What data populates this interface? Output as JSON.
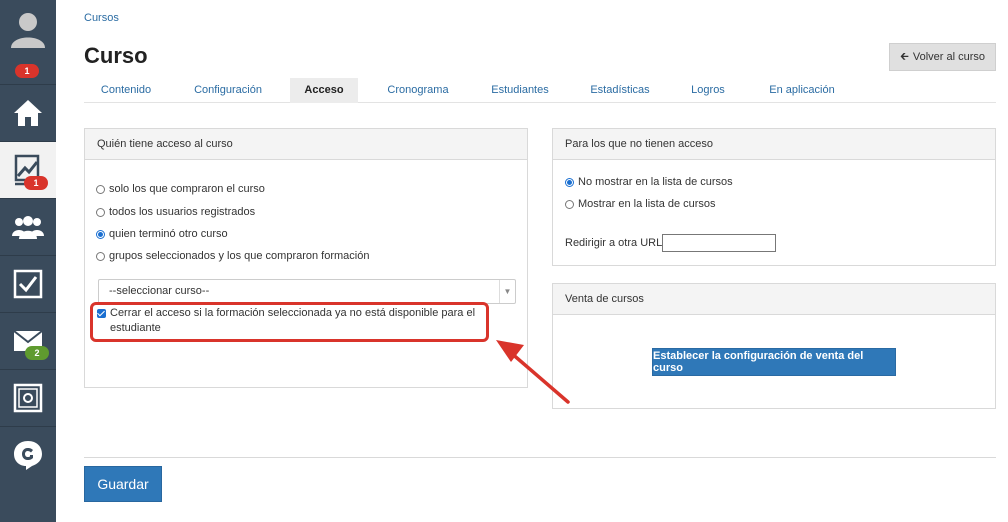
{
  "sidebar": {
    "items": [
      {
        "icon": "user-avatar-icon",
        "badge": "1",
        "badge_color": "#d9342b"
      },
      {
        "icon": "home-icon"
      },
      {
        "icon": "courses-chart-icon",
        "badge": "1",
        "badge_color": "#d9342b",
        "active": true
      },
      {
        "icon": "users-group-icon"
      },
      {
        "icon": "checkbox-tasks-icon"
      },
      {
        "icon": "mail-icon",
        "badge": "2",
        "badge_color": "#5f9b2f"
      },
      {
        "icon": "safe-icon"
      },
      {
        "icon": "brand-logo-icon"
      }
    ]
  },
  "breadcrumb": "Cursos",
  "page_title": "Curso",
  "back_button": {
    "label": "Volver al curso",
    "icon": "arrow-left-icon"
  },
  "tabs": [
    {
      "label": "Contenido"
    },
    {
      "label": "Configuración"
    },
    {
      "label": "Acceso",
      "active": true
    },
    {
      "label": "Cronograma"
    },
    {
      "label": "Estudiantes"
    },
    {
      "label": "Estadísticas"
    },
    {
      "label": "Logros"
    },
    {
      "label": "En aplicación"
    }
  ],
  "access_panel": {
    "title": "Quién tiene acceso al curso",
    "options": [
      {
        "label": "solo los que compraron el curso",
        "checked": false
      },
      {
        "label": "todos los usuarios registrados",
        "checked": false
      },
      {
        "label": "quien terminó otro curso",
        "checked": true
      },
      {
        "label": "grupos seleccionados y los que compraron formación",
        "checked": false
      }
    ],
    "course_select": "--seleccionar curso--",
    "close_access_checkbox": {
      "label": "Cerrar el acceso si la formación seleccionada ya no está disponible para el estudiante",
      "checked": true
    }
  },
  "no_access_panel": {
    "title": "Para los que no tienen acceso",
    "options": [
      {
        "label": "No mostrar en la lista de cursos",
        "checked": true
      },
      {
        "label": "Mostrar en la lista de cursos",
        "checked": false
      }
    ],
    "redirect_label": "Redirigir a otra URL",
    "redirect_value": ""
  },
  "sale_panel": {
    "title": "Venta de cursos",
    "button_label": "Establecer la configuración de venta del curso"
  },
  "save_button": "Guardar",
  "colors": {
    "sidebar": "#3a4b5c",
    "accent_blue": "#2f78b8",
    "link_blue": "#2b6ca3",
    "highlight_red": "#d9342b"
  }
}
